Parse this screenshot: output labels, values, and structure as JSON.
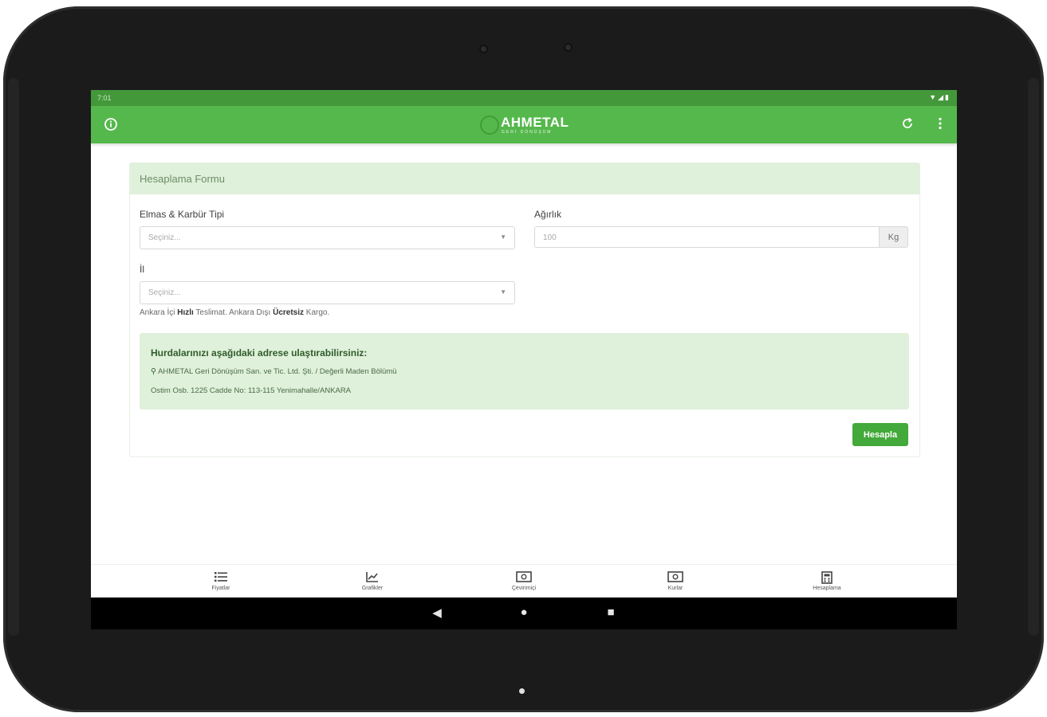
{
  "status_bar": {
    "time": "7:01",
    "icons": [
      "wifi-icon",
      "signal-icon",
      "battery-icon"
    ]
  },
  "app_bar": {
    "logo_text": "AHMETAL",
    "logo_subtext": "GERİ DÖNÜŞÜM",
    "left_icon": "info-icon",
    "refresh_icon": "refresh-icon",
    "menu_icon": "more-vert-icon"
  },
  "form": {
    "header": "Hesaplama Formu",
    "type_label": "Elmas & Karbür Tipi",
    "type_placeholder": "Seçiniz...",
    "weight_label": "Ağırlık",
    "weight_placeholder": "100",
    "weight_unit": "Kg",
    "city_label": "İl",
    "city_placeholder": "Seçiniz...",
    "note": {
      "part1": "Ankara İçi ",
      "bold1": "Hızlı",
      "part2": " Teslimat. Ankara Dışı ",
      "bold2": "Ücretsiz",
      "part3": " Kargo."
    },
    "address": {
      "title": "Hurdalarınızı aşağıdaki adrese ulaştırabilirsiniz:",
      "line1": "AHMETAL Geri Dönüşüm San. ve Tic. Ltd. Şti. / Değerli Maden Bölümü",
      "line2": "Ostim Osb. 1225 Cadde No: 113-115 Yenimahalle/ANKARA"
    },
    "submit_label": "Hesapla"
  },
  "bottom_nav": [
    {
      "label": "Fiyatlar",
      "icon": "list-icon"
    },
    {
      "label": "Grafikler",
      "icon": "chart-icon"
    },
    {
      "label": "Çevirimiçi",
      "icon": "money-icon"
    },
    {
      "label": "Kurlar",
      "icon": "currency-icon"
    },
    {
      "label": "Hesaplama",
      "icon": "calculator-icon"
    }
  ],
  "colors": {
    "primary": "#55b84c",
    "status_bar": "#43983a",
    "accent_button": "#43a93a",
    "panel": "#dff0db"
  }
}
